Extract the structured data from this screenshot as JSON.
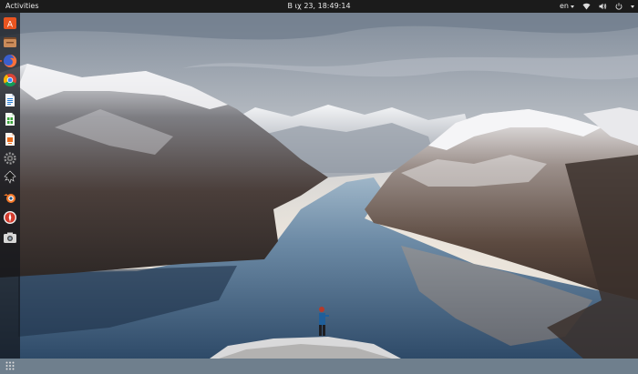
{
  "topbar": {
    "activities_label": "Activities",
    "clock_text": "Β ιχ 23, 18:49:14",
    "language": "en",
    "tray_icons": [
      "chevron-down-icon",
      "wifi-icon",
      "volume-icon",
      "power-icon"
    ]
  },
  "dock": {
    "items": [
      {
        "name": "ubuntu-software",
        "icon": "ubuntu-software-icon",
        "color": "#e95420"
      },
      {
        "name": "files",
        "icon": "file-manager-icon",
        "color": "#b5651d"
      },
      {
        "name": "firefox",
        "icon": "firefox-icon",
        "color": "#ff7139"
      },
      {
        "name": "chrome",
        "icon": "chrome-icon",
        "color": "#db4437"
      },
      {
        "name": "writer",
        "icon": "libreoffice-writer-icon",
        "color": "#2a7fd4"
      },
      {
        "name": "calc",
        "icon": "libreoffice-calc-icon",
        "color": "#3aa33a"
      },
      {
        "name": "impress",
        "icon": "libreoffice-impress-icon",
        "color": "#e86a1b"
      },
      {
        "name": "settings",
        "icon": "gear-icon",
        "color": "#8a8a8a"
      },
      {
        "name": "inkscape",
        "icon": "inkscape-icon",
        "color": "#222222"
      },
      {
        "name": "blender",
        "icon": "blender-icon",
        "color": "#f5792a"
      },
      {
        "name": "app-red",
        "icon": "compass-icon",
        "color": "#d33b2c"
      },
      {
        "name": "screenshot",
        "icon": "camera-icon",
        "color": "#e0e0e0"
      }
    ],
    "show_apps": "apps-grid-icon"
  },
  "colors": {
    "topbar_bg": "#1b1b1b",
    "accent": "#e95420",
    "sky_top": "#8a97a6",
    "sky_glow": "#f3e9dc",
    "water": "#3f5f80"
  }
}
